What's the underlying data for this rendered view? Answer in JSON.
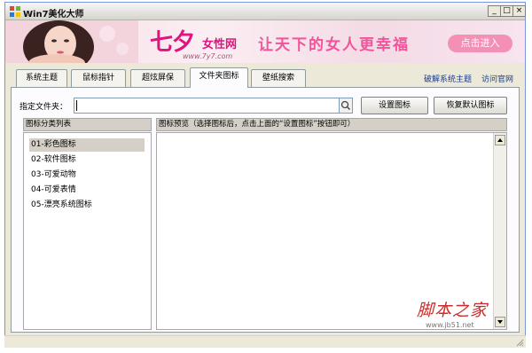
{
  "window": {
    "title": "Win7美化大师",
    "minimize": "_",
    "maximize": "□",
    "close": "×"
  },
  "banner": {
    "logo_mark": "七夕",
    "logo_name": "女性网",
    "logo_url": "www.7y7.com",
    "slogan": "让天下的女人更幸福",
    "enter_button": "点击进入"
  },
  "tabs": [
    {
      "label": "系统主题"
    },
    {
      "label": "鼠标指针"
    },
    {
      "label": "超炫屏保"
    },
    {
      "label": "文件夹图标"
    },
    {
      "label": "壁纸搜索"
    }
  ],
  "top_links": {
    "crack_theme": "破解系统主题",
    "visit_site": "访问官网"
  },
  "folder": {
    "label": "指定文件夹：",
    "value": "",
    "set_icon_button": "设置图标",
    "restore_button": "恢复默认图标"
  },
  "category_list": {
    "header": "图标分类列表",
    "items": [
      {
        "label": "01-彩色图标"
      },
      {
        "label": "02-软件图标"
      },
      {
        "label": "03-可爱动物"
      },
      {
        "label": "04-可爱表情"
      },
      {
        "label": "05-漂亮系统图标"
      }
    ],
    "selected_index": 0
  },
  "preview": {
    "header": "图标预览（选择图标后，点击上面的“设置图标”按钮即可）"
  },
  "watermark": {
    "text": "脚本之家",
    "url": "www.jb51.net"
  },
  "colors": {
    "brand_pink": "#e2127e",
    "slogan_pink": "#f2549b",
    "link_blue": "#1a3d8a"
  }
}
